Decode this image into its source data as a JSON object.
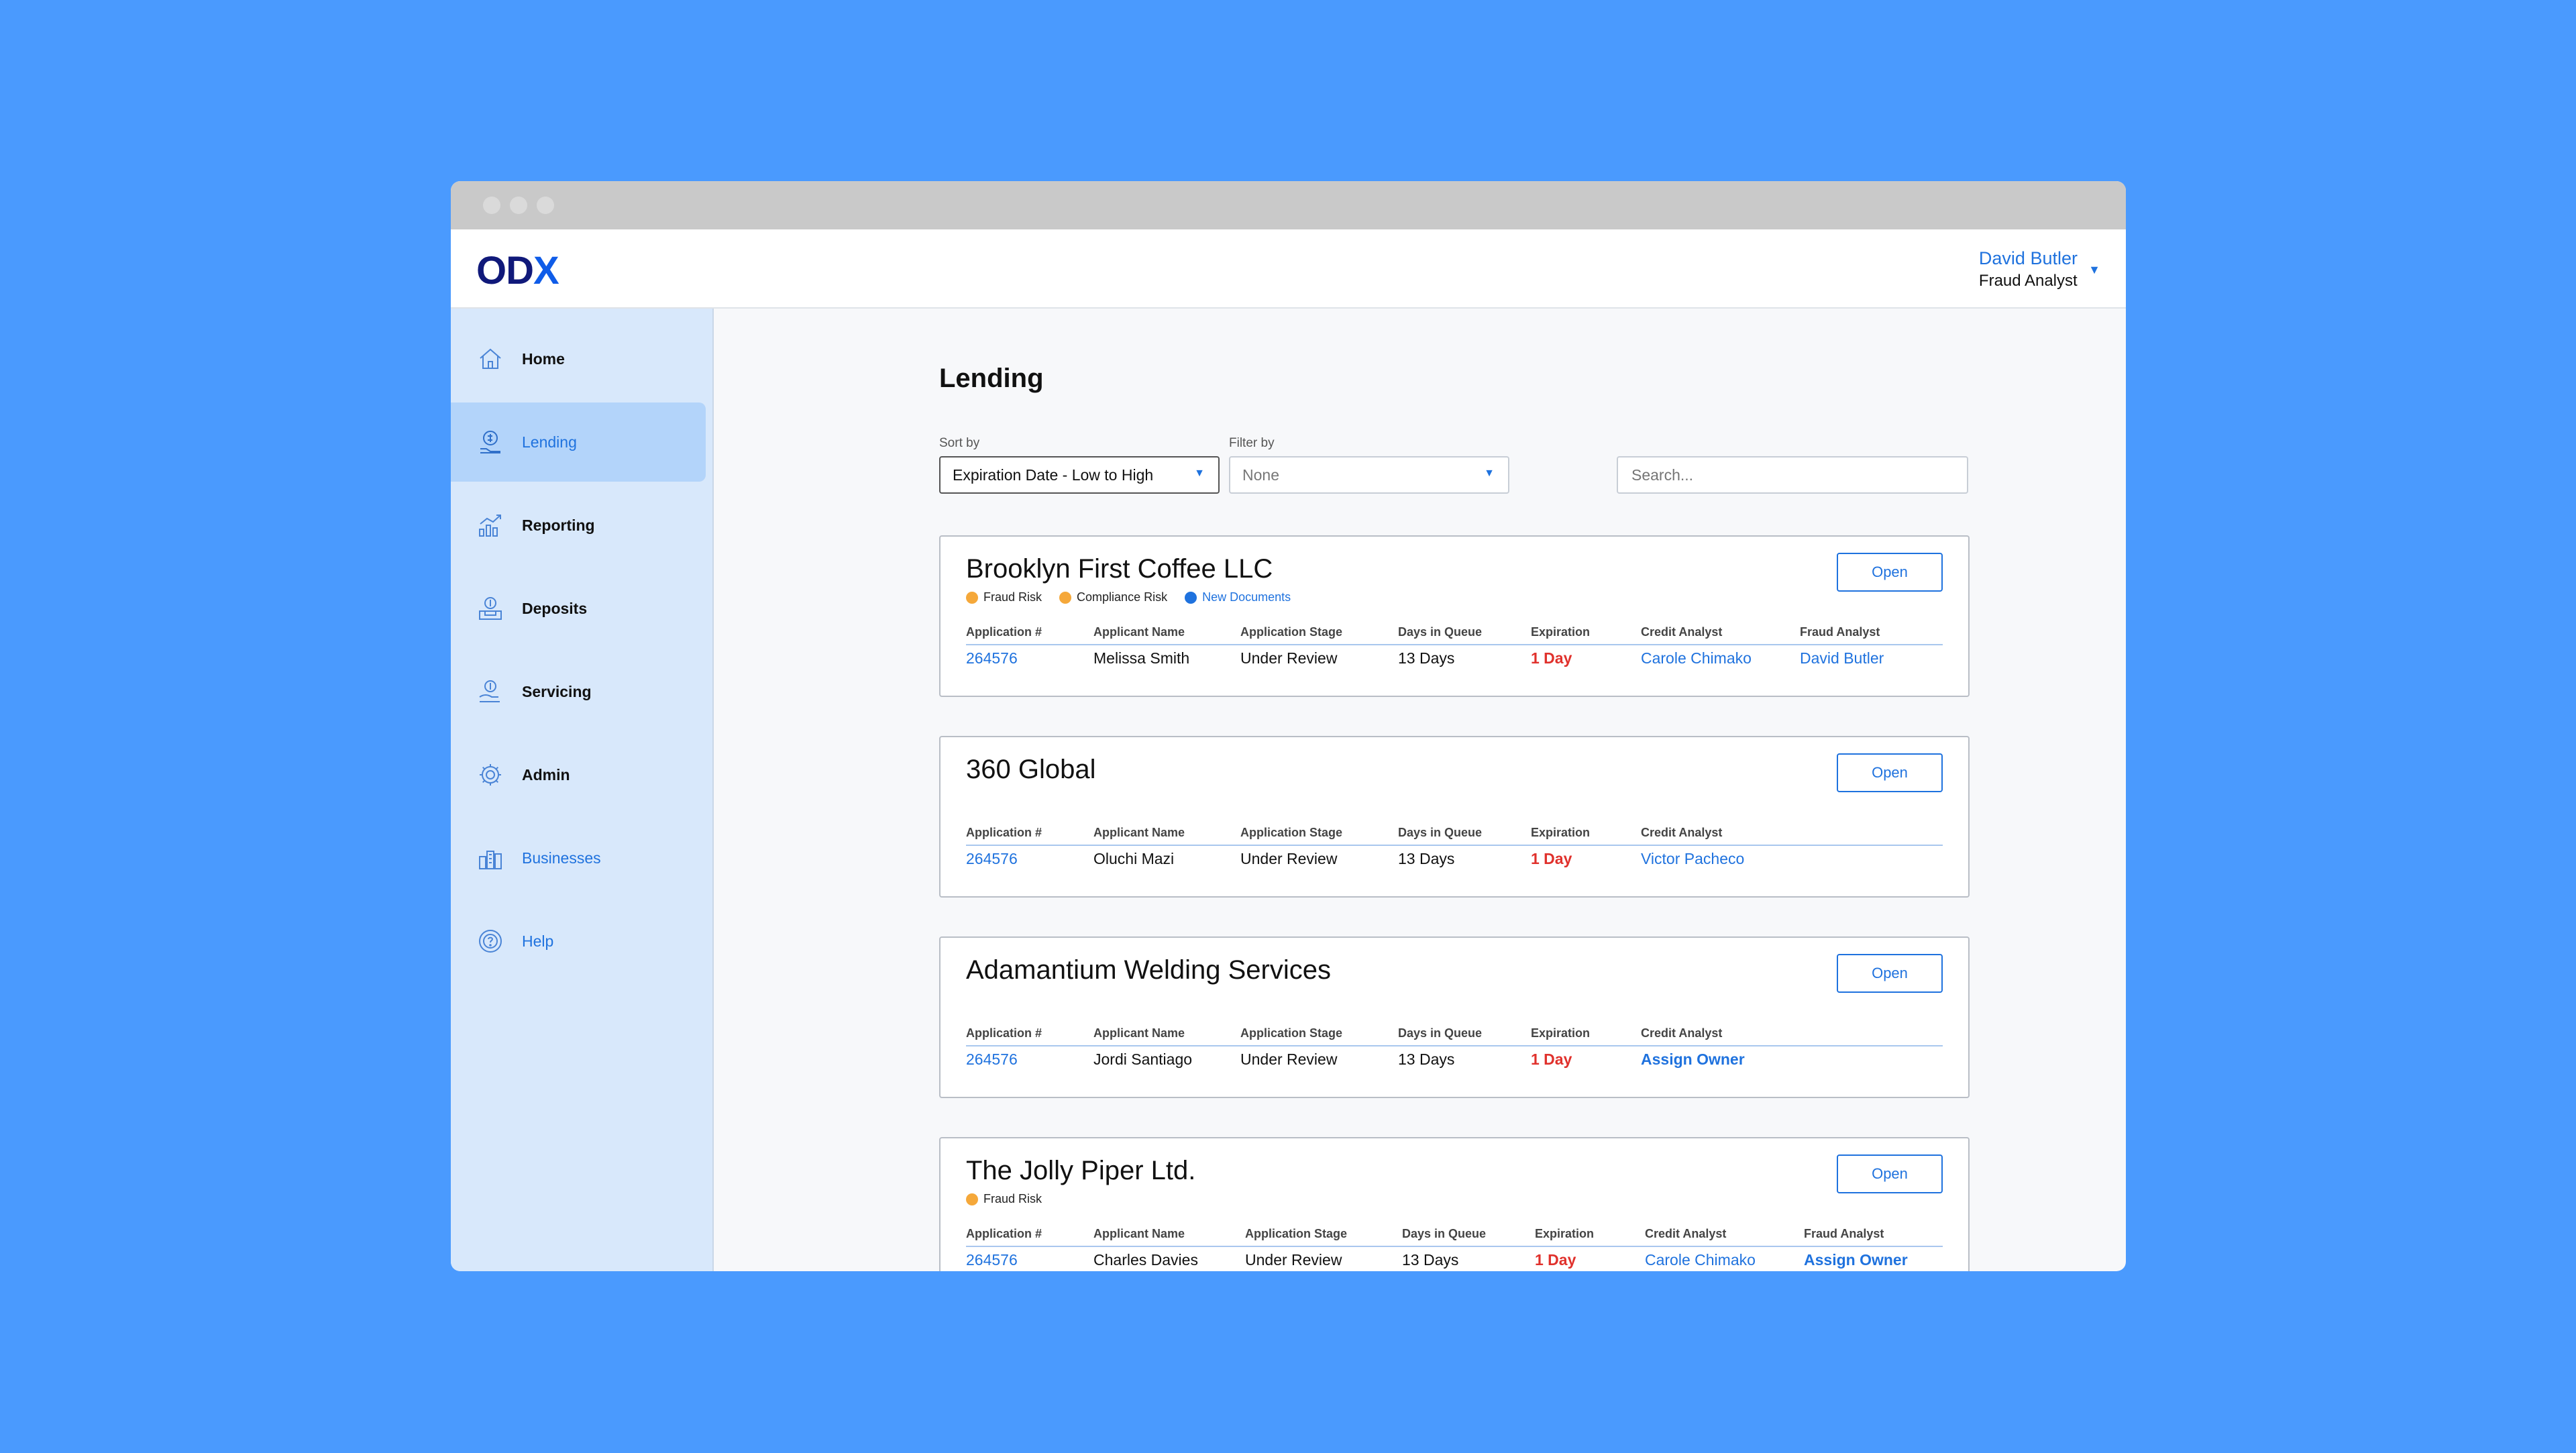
{
  "app": {
    "logo_main": "OD",
    "logo_accent": "X",
    "user_name": "David Butler",
    "user_role": "Fraud Analyst"
  },
  "sidebar": {
    "items": [
      {
        "label": "Home",
        "icon": "home-icon",
        "active": false
      },
      {
        "label": "Lending",
        "icon": "lending-icon",
        "active": true
      },
      {
        "label": "Reporting",
        "icon": "reporting-icon",
        "active": false
      },
      {
        "label": "Deposits",
        "icon": "deposits-icon",
        "active": false
      },
      {
        "label": "Servicing",
        "icon": "servicing-icon",
        "active": false
      },
      {
        "label": "Admin",
        "icon": "gear-icon",
        "active": false
      },
      {
        "label": "Businesses",
        "icon": "businesses-icon",
        "active": false
      },
      {
        "label": "Help",
        "icon": "help-icon",
        "active": false
      }
    ]
  },
  "main": {
    "title": "Lending",
    "sort_label": "Sort by",
    "sort_value": "Expiration Date - Low to High",
    "filter_label": "Filter by",
    "filter_value": "None",
    "search_placeholder": "Search..."
  },
  "columns": [
    "Application #",
    "Applicant Name",
    "Application Stage",
    "Days in Queue",
    "Expiration",
    "Credit Analyst",
    "Fraud Analyst"
  ],
  "cards": [
    {
      "name": "Brooklyn First Coffee LLC",
      "tags": [
        {
          "label": "Fraud Risk",
          "color": "#f5a83a"
        },
        {
          "label": "Compliance Risk",
          "color": "#f5a83a"
        },
        {
          "label": "New Documents",
          "color": "#1f72de"
        }
      ],
      "open_label": "Open",
      "row": {
        "app": "264576",
        "applicant": "Melissa Smith",
        "stage": "Under Review",
        "days": "13 Days",
        "expiration": "1 Day",
        "credit": "Carole Chimako",
        "fraud": "David Butler"
      }
    },
    {
      "name": "360 Global",
      "tags": [],
      "open_label": "Open",
      "row": {
        "app": "264576",
        "applicant": "Oluchi Mazi",
        "stage": "Under Review",
        "days": "13 Days",
        "expiration": "1 Day",
        "credit": "Victor Pacheco"
      }
    },
    {
      "name": "Adamantium Welding Services",
      "tags": [],
      "open_label": "Open",
      "row": {
        "app": "264576",
        "applicant": "Jordi Santiago",
        "stage": "Under Review",
        "days": "13 Days",
        "expiration": "1 Day",
        "credit": "Assign Owner"
      }
    },
    {
      "name": "The Jolly Piper Ltd.",
      "tags": [
        {
          "label": "Fraud Risk",
          "color": "#f5a83a"
        }
      ],
      "open_label": "Open",
      "row": {
        "app": "264576",
        "applicant": "Charles Davies",
        "stage": "Under Review",
        "days": "13 Days",
        "expiration": "1 Day",
        "credit": "Carole Chimako",
        "fraud": "Assign Owner"
      }
    }
  ]
}
